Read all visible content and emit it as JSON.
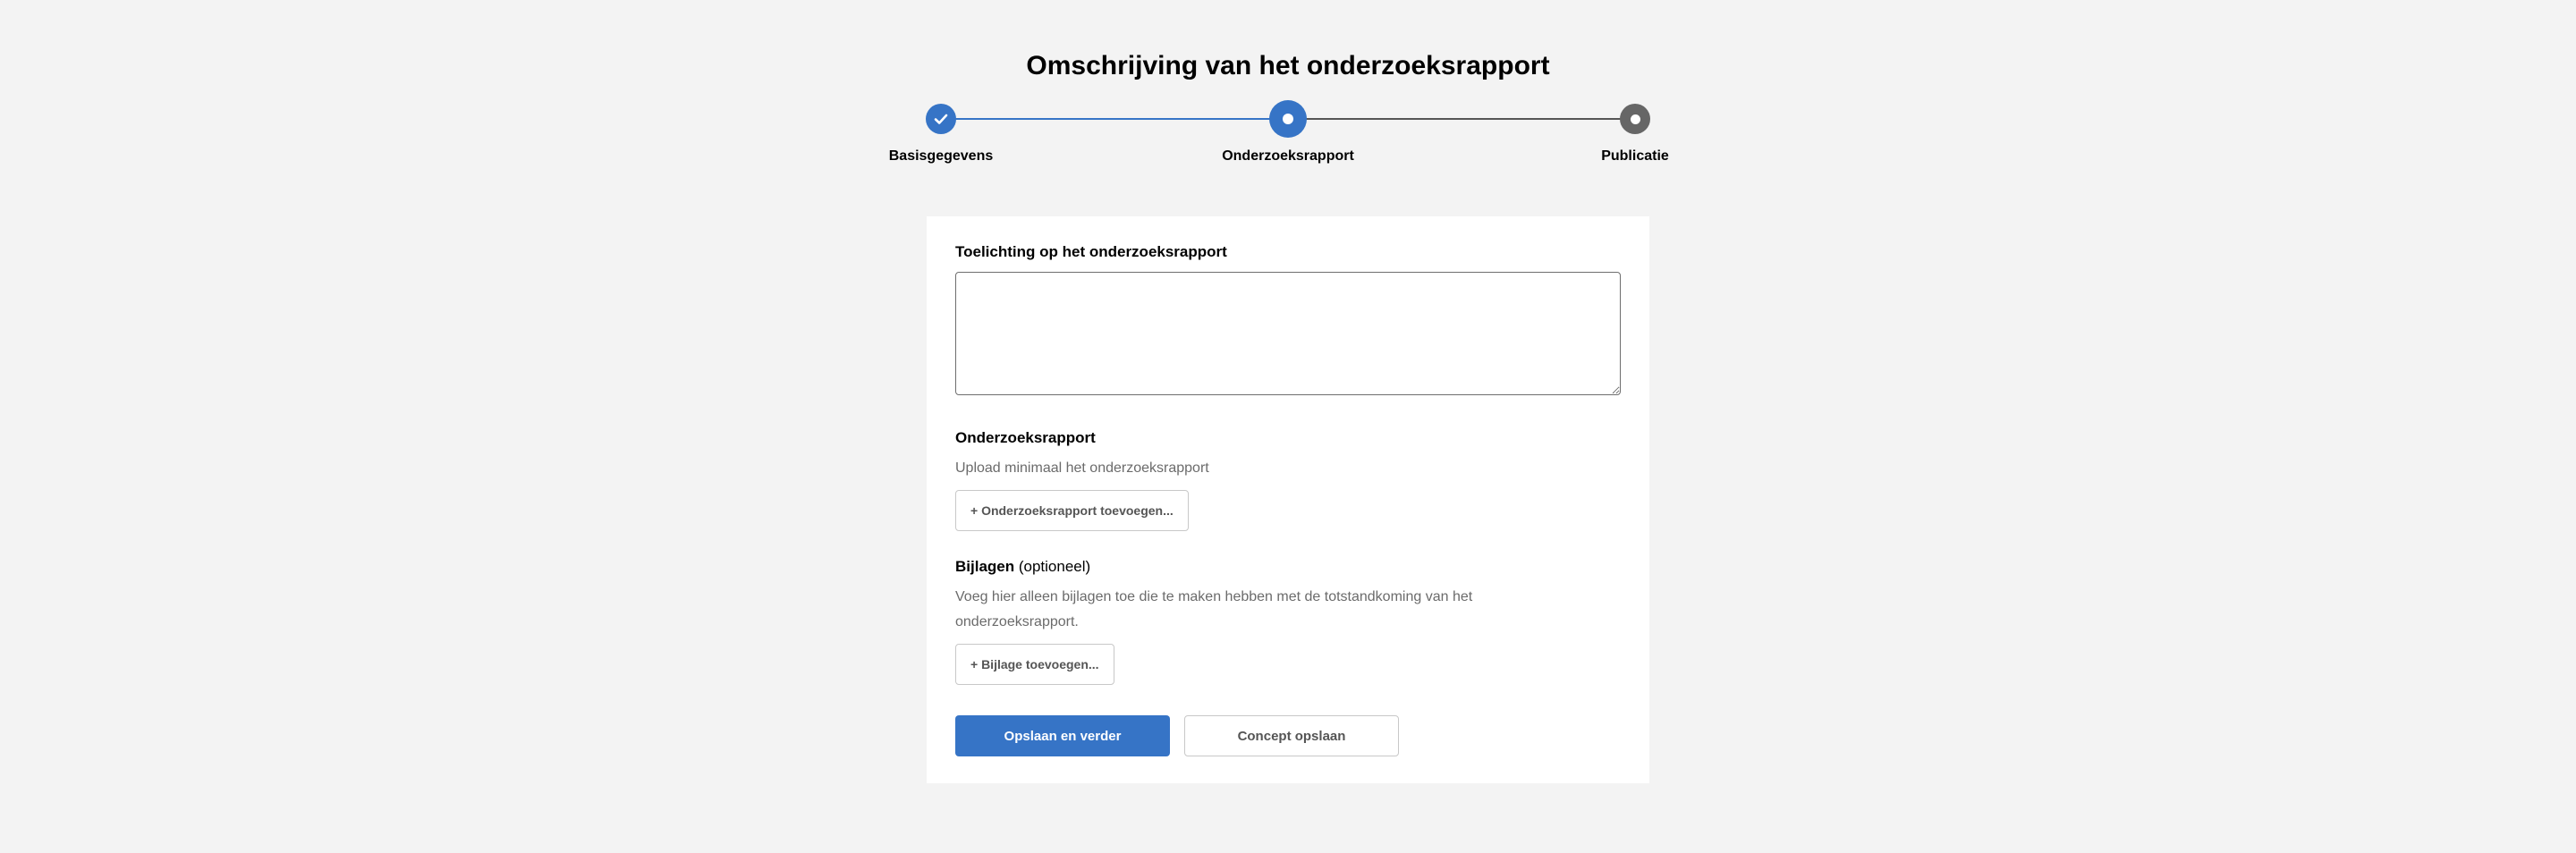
{
  "page": {
    "title": "Omschrijving van het onderzoeksrapport"
  },
  "stepper": {
    "steps": [
      {
        "label": "Basisgegevens",
        "status": "complete",
        "icon": "check-icon"
      },
      {
        "label": "Onderzoeksrapport",
        "status": "current",
        "icon": "dot-icon"
      },
      {
        "label": "Publicatie",
        "status": "upcoming",
        "icon": "dot-icon"
      }
    ],
    "colors": {
      "active": "#3674c6",
      "inactive": "#666666"
    }
  },
  "form": {
    "explanation": {
      "label": "Toelichting op het onderzoeksrapport",
      "value": ""
    },
    "report": {
      "label": "Onderzoeksrapport",
      "help": "Upload minimaal het onderzoeksrapport",
      "add_button": "+ Onderzoeksrapport toevoegen..."
    },
    "attachments": {
      "label": "Bijlagen",
      "optional": "(optioneel)",
      "help": "Voeg hier alleen bijlagen toe die te maken hebben met de totstandkoming van het onderzoeksrapport.",
      "add_button": "+ Bijlage toevoegen..."
    },
    "actions": {
      "save_continue": "Opslaan en verder",
      "save_draft": "Concept opslaan"
    }
  }
}
